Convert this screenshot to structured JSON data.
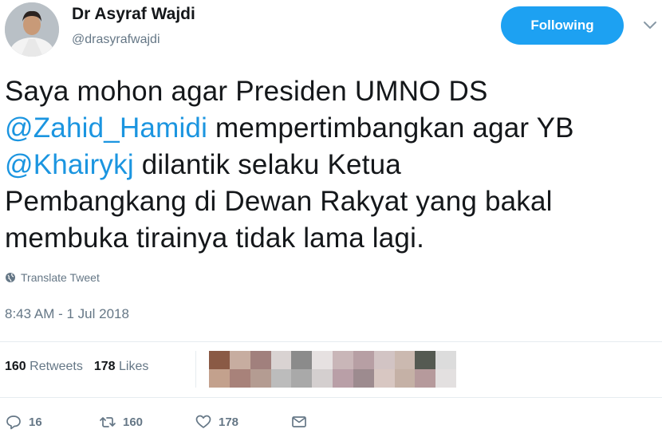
{
  "author": {
    "name": "Dr Asyraf Wajdi",
    "handle": "@drasyrafwajdi"
  },
  "follow_button": {
    "label": "Following"
  },
  "menu": {
    "icon": "chevron-down-icon"
  },
  "tweet": {
    "line1": "Saya mohon agar Presiden UMNO DS",
    "mention1": "@Zahid_Hamidi",
    "line2_rest": " mempertimbangkan agar YB",
    "mention2": "@Khairykj",
    "line3_rest": " dilantik selaku Ketua",
    "line4": "Pembangkang di Dewan Rakyat yang bakal",
    "line5": "membuka tirainya tidak lama lagi."
  },
  "translate": {
    "label": "Translate Tweet",
    "icon": "globe-icon"
  },
  "timestamp": "8:43 AM - 1 Jul 2018",
  "stats": {
    "retweets_count": "160",
    "retweets_label": "Retweets",
    "likes_count": "178",
    "likes_label": "Likes"
  },
  "actions": {
    "reply_count": "16",
    "retweet_count": "160",
    "like_count": "178",
    "reply_icon": "reply-icon",
    "retweet_icon": "retweet-icon",
    "like_icon": "heart-icon",
    "dm_icon": "message-icon"
  },
  "colors": {
    "accent": "#1da1f2",
    "mention": "#1b95e0",
    "muted": "#657786",
    "text": "#14171a"
  }
}
